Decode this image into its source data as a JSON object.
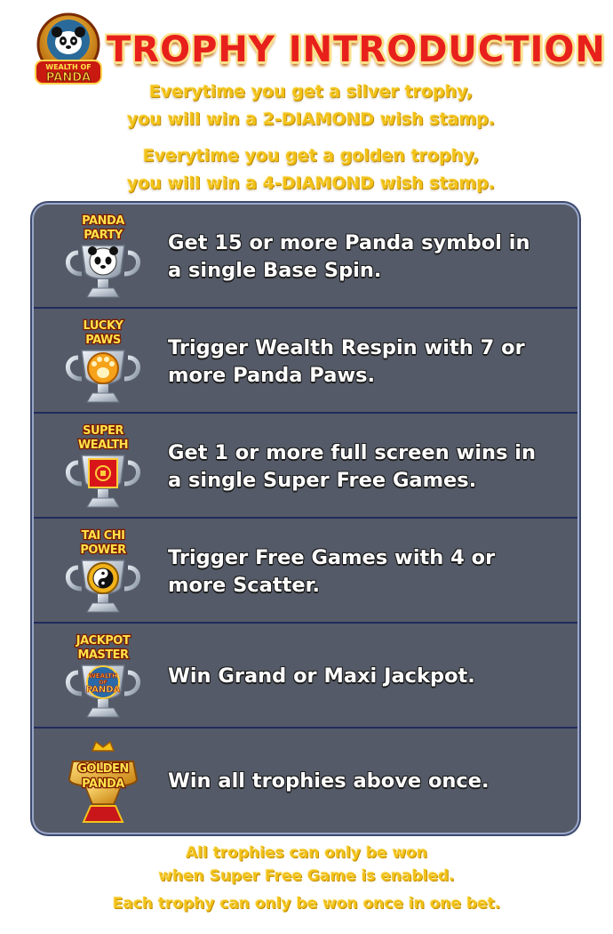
{
  "header": {
    "logo_text": [
      "WEALTH OF",
      "PANDA"
    ],
    "title": "TROPHY INTRODUCTION",
    "intro": [
      "Everytime you get a silver trophy,\nyou will win a 2-DIAMOND wish stamp.",
      "Everytime you get a golden trophy,\nyou will win a 4-DIAMOND wish stamp."
    ]
  },
  "trophies": [
    {
      "label_lines": [
        "PANDA",
        "PARTY"
      ],
      "type": "silver",
      "emblem": "panda-face-icon",
      "description": "Get 15 or more Panda symbol in\na single Base Spin."
    },
    {
      "label_lines": [
        "LUCKY",
        "PAWS"
      ],
      "type": "silver",
      "emblem": "paw-icon",
      "description": "Trigger Wealth Respin with 7 or\n more Panda Paws."
    },
    {
      "label_lines": [
        "SUPER",
        "WEALTH"
      ],
      "type": "silver",
      "emblem": "red-box-icon",
      "description": "Get 1 or more full screen wins in\n a single Super Free Games."
    },
    {
      "label_lines": [
        "TAI CHI",
        "POWER"
      ],
      "type": "silver",
      "emblem": "yin-yang-icon",
      "description": "Trigger Free Games with 4 or\nmore Scatter."
    },
    {
      "label_lines": [
        "JACKPOT",
        "MASTER"
      ],
      "type": "silver",
      "emblem": "wealth-logo-icon",
      "emblem_text": [
        "WEALTH",
        "OF",
        "PANDA"
      ],
      "description": "Win Grand or Maxi Jackpot."
    },
    {
      "label_lines": [
        "GOLDEN",
        "PANDA"
      ],
      "type": "golden",
      "emblem": "crown-icon",
      "description": "Win all trophies above once."
    }
  ],
  "footer": [
    "All trophies can only be won\nwhen Super Free Game is enabled.",
    "Each trophy can only be won once in one bet."
  ],
  "colors": {
    "panel_bg": "#545a67",
    "panel_border": "#9aa6c6",
    "row_divider": "#202b5c",
    "title_red": "#e8201b",
    "gold_text": "#f2c21a",
    "silver": "#b9c3cf",
    "gold": "#e8a417"
  }
}
